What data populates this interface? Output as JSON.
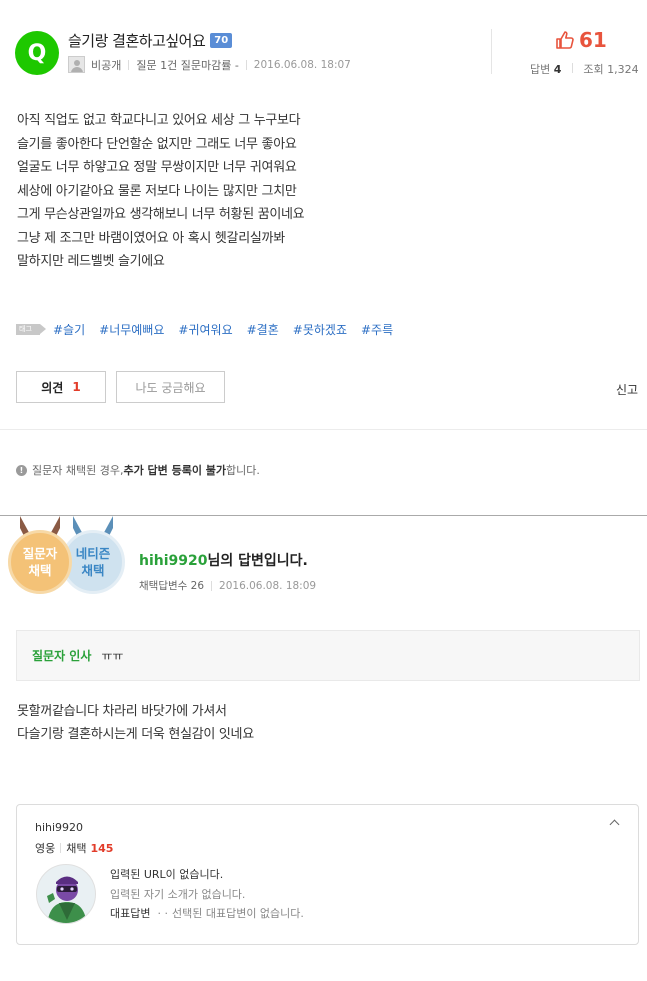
{
  "question": {
    "icon_letter": "Q",
    "title": "슬기랑 결혼하고싶어요",
    "badge": "70",
    "author": "비공개",
    "question_info": "질문 1건 질문마감률 -",
    "date": "2016.06.08. 18:07",
    "likes": "61",
    "answers_label": "답변",
    "answers_count": "4",
    "views_label": "조회",
    "views_count": "1,324",
    "body": [
      "아직 직업도 없고 학교다니고 있어요 세상 그 누구보다",
      "슬기를 좋아한다 단언할순 없지만 그래도 너무 좋아요",
      "얼굴도 너무 하얗고요 정말 무쌍이지만 너무 귀여워요",
      "세상에 아기같아요 물론 저보다 나이는 많지만 그치만",
      "그게 무슨상관일까요 생각해보니 너무 허황된 꿈이네요",
      "그냥 제 조그만 바램이였어요 아 혹시 헷갈리실까봐",
      "말하지만 레드벨벳 슬기에요"
    ],
    "tag_label": "태그",
    "tags": [
      "#슬기",
      "#너무예뻐요",
      "#귀여워요",
      "#결혼",
      "#못하겠죠",
      "#주륵"
    ],
    "opinion_label": "의견",
    "opinion_count": "1",
    "curious_label": "나도 궁금해요",
    "report_label": "신고"
  },
  "notice": {
    "prefix": "질문자 채택된 경우, ",
    "bold": "추가 답변 등록이 불가",
    "suffix": "합니다."
  },
  "answer": {
    "medal_1": [
      "질문자",
      "채택"
    ],
    "medal_2": [
      "네티즌",
      "채택"
    ],
    "user_id": "hihi9920",
    "user_suffix": "님의 답변입니다.",
    "adopted_label": "채택답변수",
    "adopted_count": "26",
    "date": "2016.06.08. 18:09",
    "greeting_label": "질문자 인사",
    "greeting_text": "ㅠㅠ",
    "body": [
      "못할꺼같습니다 차라리 바닷가에 가셔서",
      "다슬기랑 결혼하시는게 더욱 현실감이 잇네요"
    ]
  },
  "profile": {
    "name": "hihi9920",
    "rank": "영웅",
    "adopt_label": "채택",
    "adopt_count": "145",
    "url_line": "입력된 URL이 없습니다.",
    "intro_line": "입력된 자기 소개가 없습니다.",
    "rep_label": "대표답변",
    "rep_text": "선택된 대표답변이 없습니다."
  },
  "colors": {
    "green": "#1ec800",
    "like_red": "#e8543d",
    "tag_blue": "#2d6fc4",
    "answer_green": "#2aa13a"
  }
}
